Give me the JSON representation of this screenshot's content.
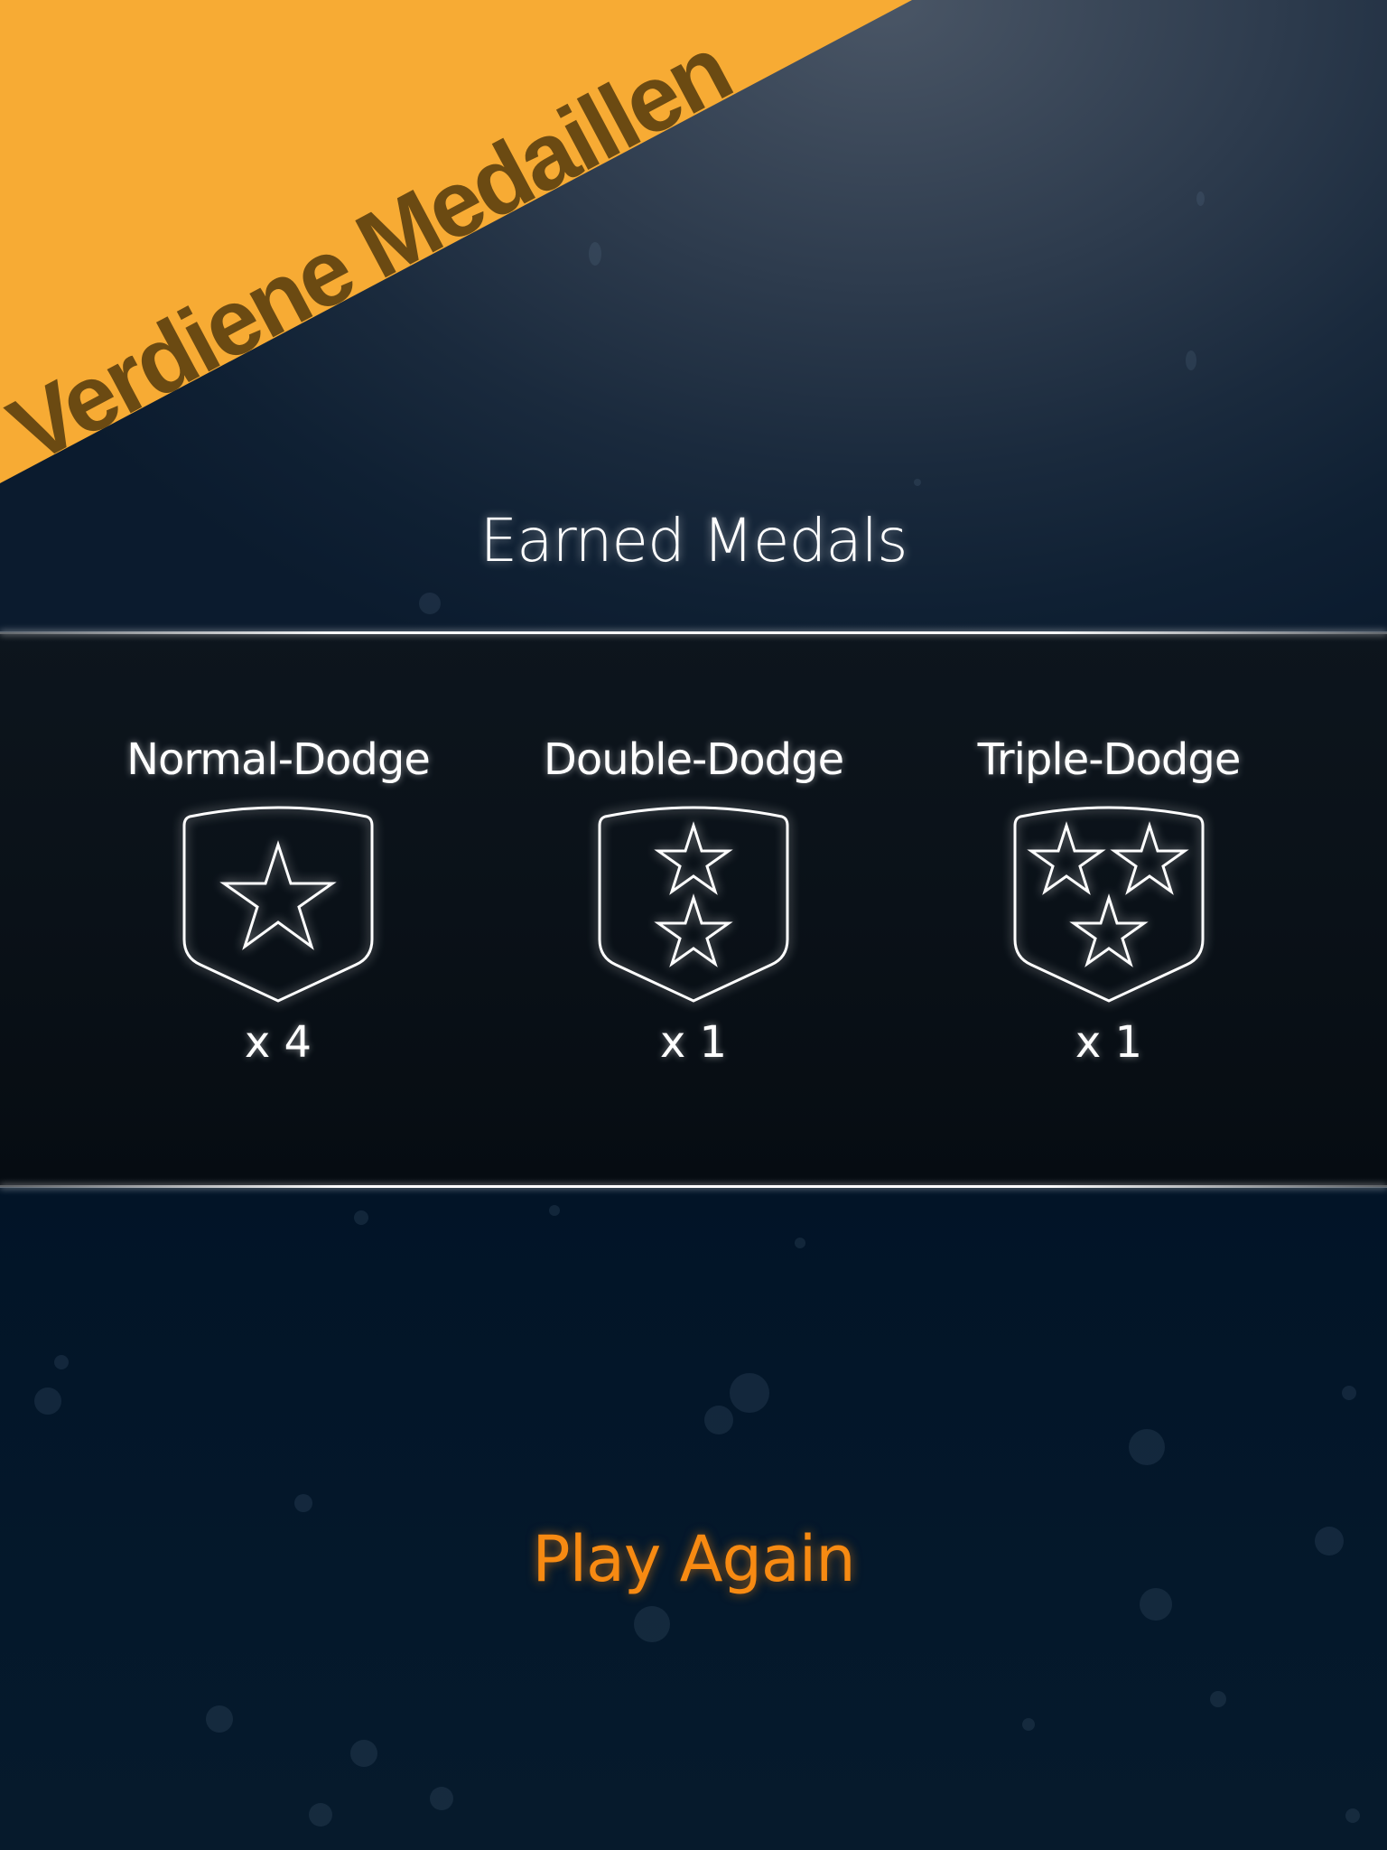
{
  "banner": {
    "text": "Verdiene Medaillen",
    "color": "#f7ab34"
  },
  "heading": "Earned Medals",
  "medals": [
    {
      "name": "Normal-Dodge",
      "count": "x 4",
      "icon": "shield-one-star-icon"
    },
    {
      "name": "Double-Dodge",
      "count": "x 1",
      "icon": "shield-two-stars-icon"
    },
    {
      "name": "Triple-Dodge",
      "count": "x 1",
      "icon": "shield-three-stars-icon"
    }
  ],
  "play_again": "Play Again",
  "colors": {
    "accent": "#f78a12",
    "banner": "#f7ab34",
    "text": "#ffffff"
  }
}
